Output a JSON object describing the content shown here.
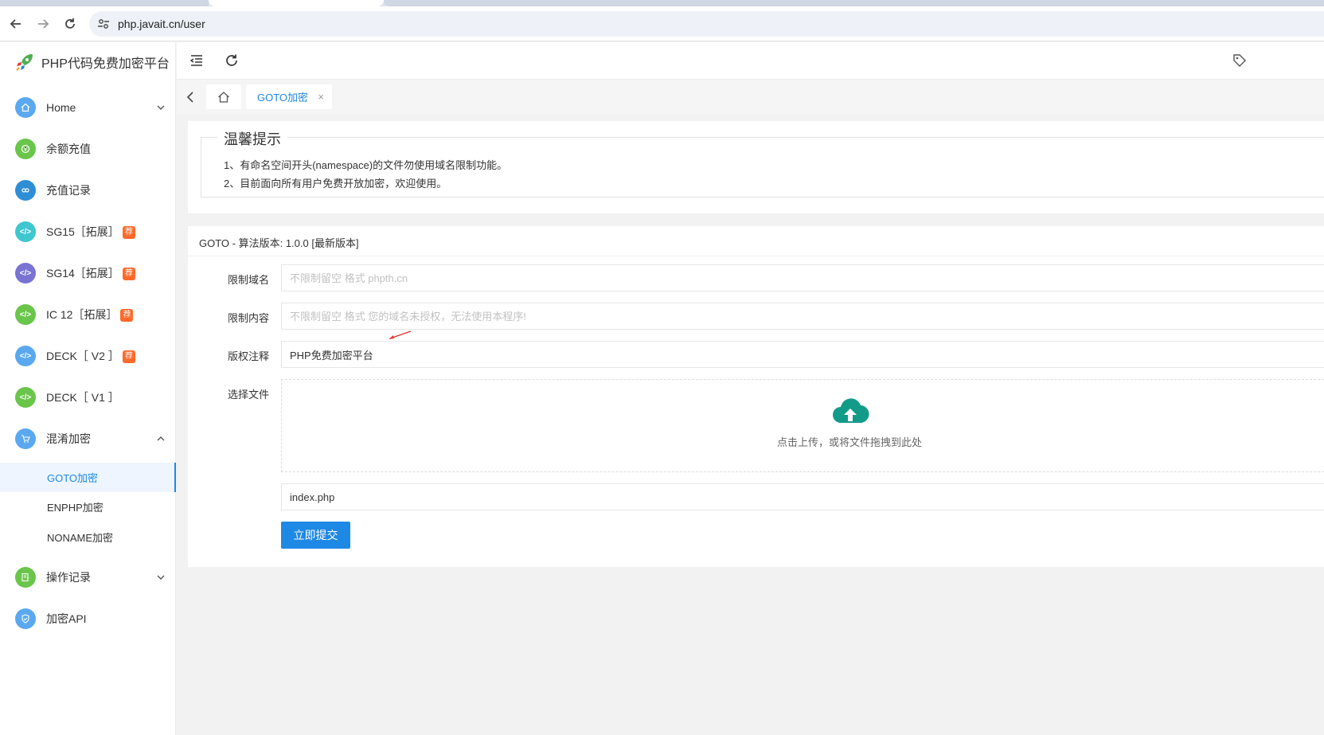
{
  "browser": {
    "url": "php.javait.cn/user"
  },
  "sidebar": {
    "logo_text": "PHP代码免费加密平台",
    "items": [
      {
        "label": "Home",
        "badge": "",
        "color": "#5aa9f0",
        "icon": "home-icon"
      },
      {
        "label": "余额充值",
        "badge": "",
        "color": "#6ac54b",
        "icon": "recharge-icon"
      },
      {
        "label": "充值记录",
        "badge": "",
        "color": "#2e8ed6",
        "icon": "record-icon"
      },
      {
        "label": "SG15［拓展］",
        "badge": "荐",
        "color": "#3fc7cf",
        "icon": "code-icon"
      },
      {
        "label": "SG14［拓展］",
        "badge": "荐",
        "color": "#7a73d4",
        "icon": "code-icon"
      },
      {
        "label": "IC 12［拓展］",
        "badge": "荐",
        "color": "#6ac54b",
        "icon": "code-icon"
      },
      {
        "label": "DECK［ V2 ］",
        "badge": "荐",
        "color": "#5aa9f0",
        "icon": "code-icon"
      },
      {
        "label": "DECK［ V1 ］",
        "badge": "",
        "color": "#6ac54b",
        "icon": "code-icon"
      },
      {
        "label": "混淆加密",
        "badge": "",
        "color": "#5aa9f0",
        "icon": "cart-icon"
      },
      {
        "label": "操作记录",
        "badge": "",
        "color": "#6ac54b",
        "icon": "edit-icon"
      },
      {
        "label": "加密API",
        "badge": "",
        "color": "#5aa9f0",
        "icon": "shield-icon"
      }
    ],
    "sub_items": [
      {
        "label": "GOTO加密"
      },
      {
        "label": "ENPHP加密"
      },
      {
        "label": "NONAME加密"
      }
    ]
  },
  "tabbar": {
    "active_tab": "GOTO加密",
    "close": "×"
  },
  "notice": {
    "title": "温馨提示",
    "lines": [
      "1、有命名空间开头(namespace)的文件勿使用域名限制功能。",
      "2、目前面向所有用户免费开放加密，欢迎使用。"
    ]
  },
  "form": {
    "title": "GOTO - 算法版本: 1.0.0 [最新版本]",
    "domain_label": "限制域名",
    "domain_placeholder": "不限制留空 格式 phpth.cn",
    "content_label": "限制内容",
    "content_placeholder": "不限制留空 格式 您的域名未授权，无法使用本程序!",
    "copyright_label": "版权注释",
    "copyright_value": "PHP免费加密平台",
    "file_label": "选择文件",
    "upload_text": "点击上传，或将文件拖拽到此处",
    "file_value": "index.php",
    "submit_label": "立即提交"
  },
  "colors": {
    "accent": "#1e88e5",
    "upload_icon": "#139b8a",
    "badge": "#ff6a2b"
  }
}
